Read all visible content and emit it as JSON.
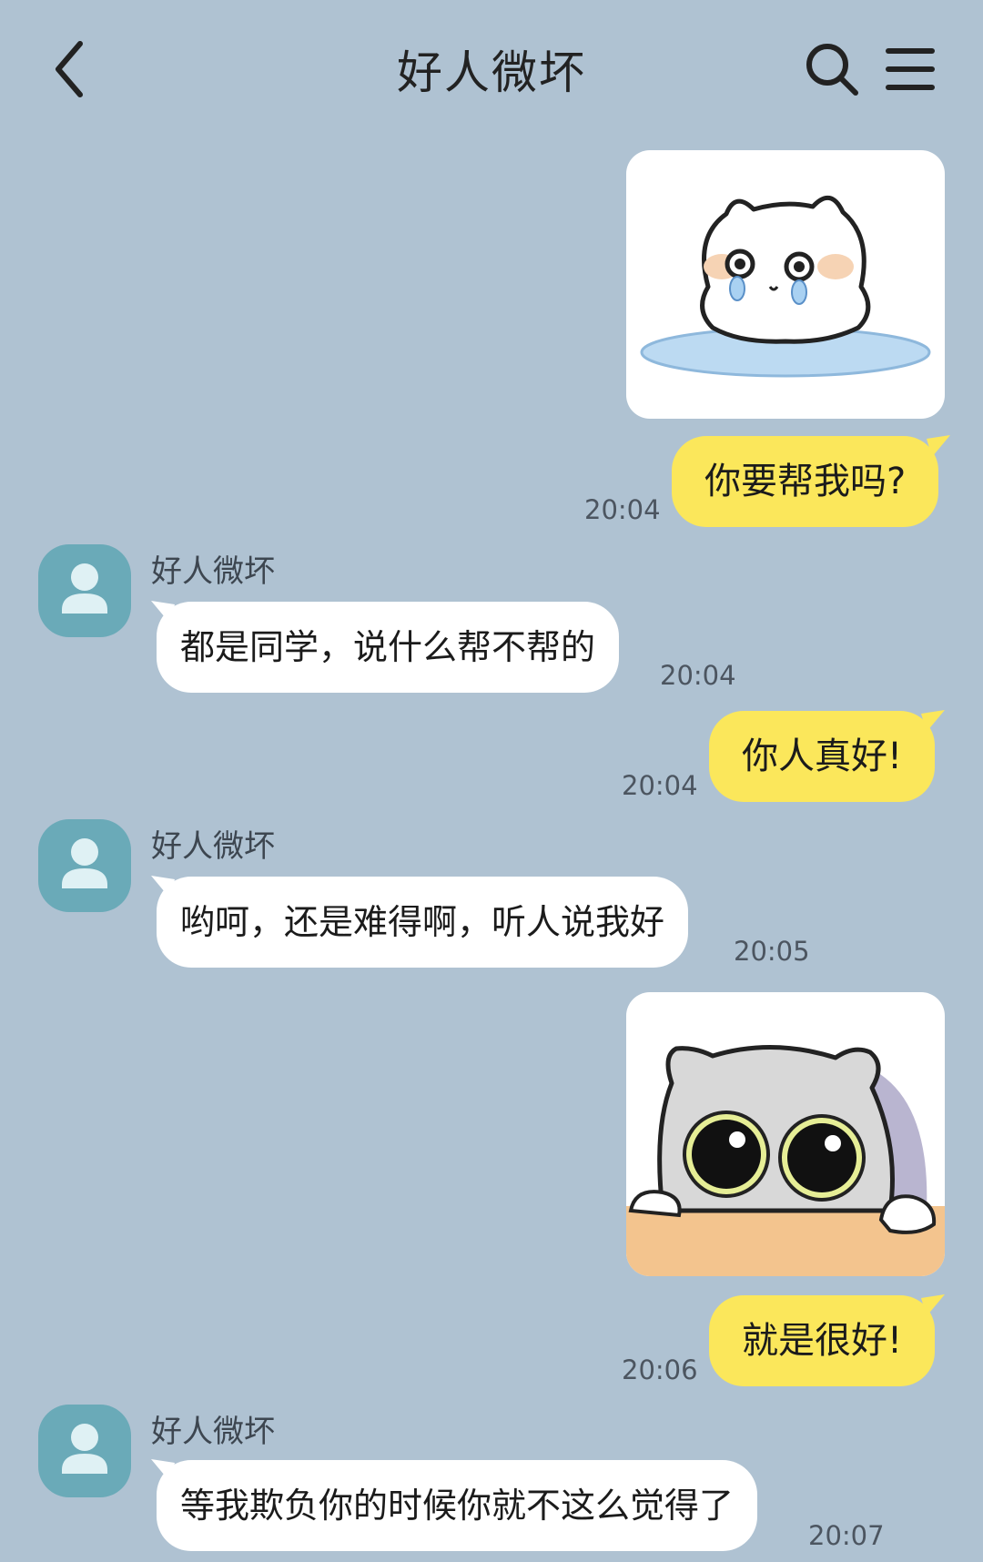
{
  "header": {
    "title": "好人微坏",
    "back_icon": "chevron-left-icon",
    "search_icon": "search-icon",
    "menu_icon": "menu-icon"
  },
  "messages": [
    {
      "type": "sticker",
      "direction": "out",
      "sticker": "crying-white-cat-sticker"
    },
    {
      "type": "text",
      "direction": "out",
      "text": "你要帮我吗?",
      "time": "20:04"
    },
    {
      "type": "text",
      "direction": "in",
      "sender": "好人微坏",
      "text": "都是同学，说什么帮不帮的",
      "time": "20:04"
    },
    {
      "type": "text",
      "direction": "out",
      "text": "你人真好!",
      "time": "20:04"
    },
    {
      "type": "text",
      "direction": "in",
      "sender": "好人微坏",
      "text": "哟呵，还是难得啊，听人说我好",
      "time": "20:05"
    },
    {
      "type": "sticker",
      "direction": "out",
      "sticker": "peeking-gray-cat-sticker"
    },
    {
      "type": "text",
      "direction": "out",
      "text": "就是很好!",
      "time": "20:06"
    },
    {
      "type": "text",
      "direction": "in",
      "sender": "好人微坏",
      "text": "等我欺负你的时候你就不这么觉得了",
      "time": "20:07"
    }
  ],
  "colors": {
    "background": "#afc2d2",
    "outgoing_bubble": "#fbe75b",
    "incoming_bubble": "#ffffff",
    "avatar": "#6aaab8"
  }
}
